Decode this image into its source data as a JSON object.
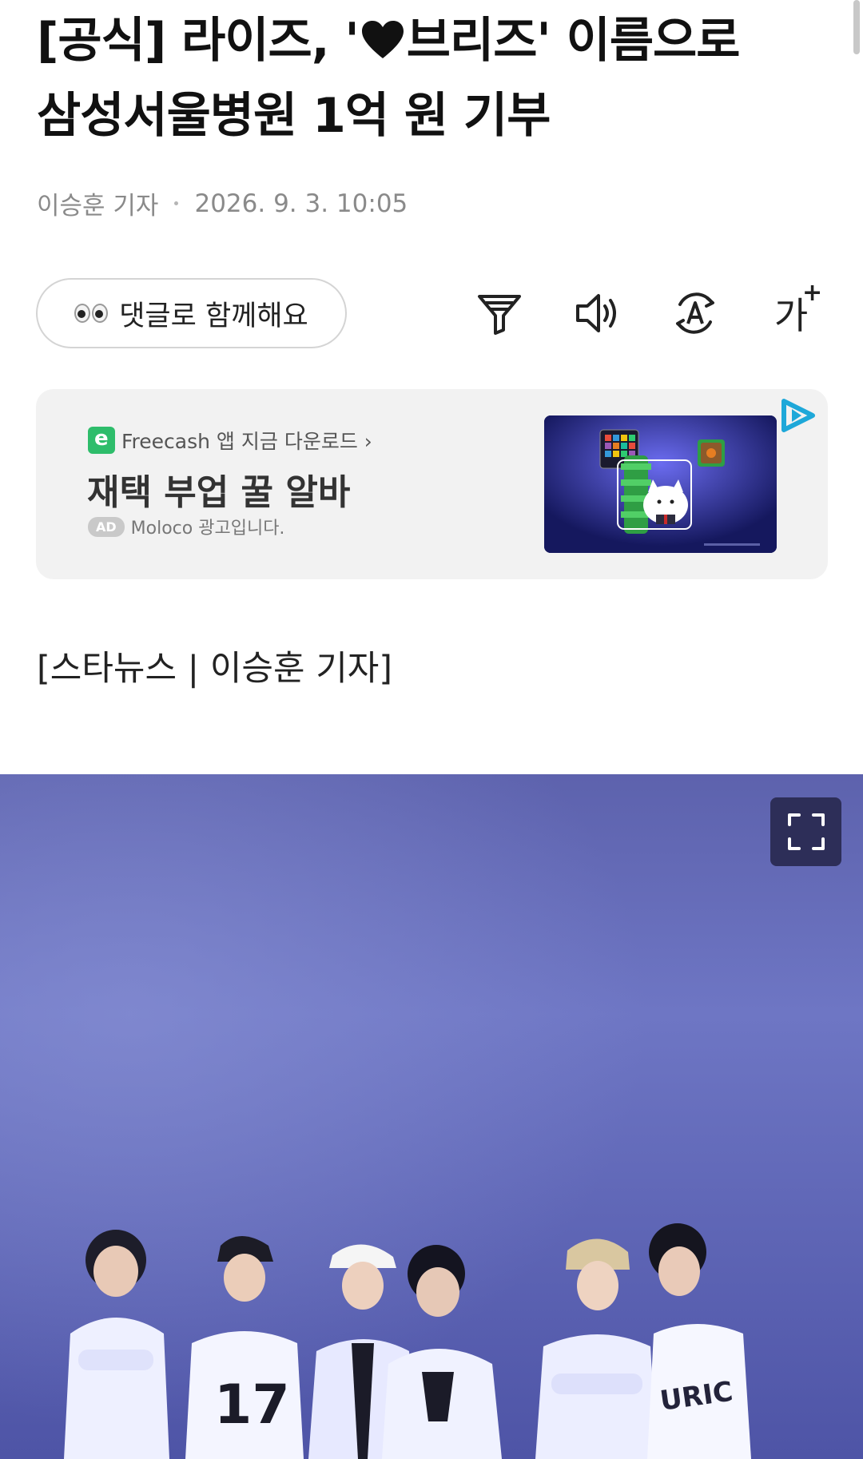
{
  "article": {
    "headline_part1": "[공식] 라이즈, '",
    "headline_part2": "브리즈' 이름으로",
    "headline_line2": "삼성서울병원 1억 원 기부",
    "heart_icon": "heart-icon",
    "author": "이승훈 기자",
    "timestamp": "2026. 9. 3. 10:05",
    "source_line": "[스타뉴스 | 이승훈 기자]"
  },
  "toolbar": {
    "comment_label": "댓글로 함께해요",
    "comment_icon": "eyes-icon",
    "summary_icon": "filter-icon",
    "audio_icon": "speaker-icon",
    "translate_icon": "translate-icon",
    "font_size_label": "가",
    "font_size_plus": "+"
  },
  "ad": {
    "brand": "Freecash 앱 지금 다운로드 ›",
    "title": "재택 부업 꿀 알바",
    "badge": "AD",
    "advertiser": "Moloco 광고입니다.",
    "choices_icon": "adchoices-icon"
  },
  "photo": {
    "expand_icon": "expand-icon"
  },
  "colors": {
    "photo_bg": "#6a6fb8",
    "ad_bg": "#f2f2f2",
    "expand_bg": "#2d2e58",
    "adchoices": "#1ea8d9",
    "freecash_green": "#2ebd6b"
  }
}
